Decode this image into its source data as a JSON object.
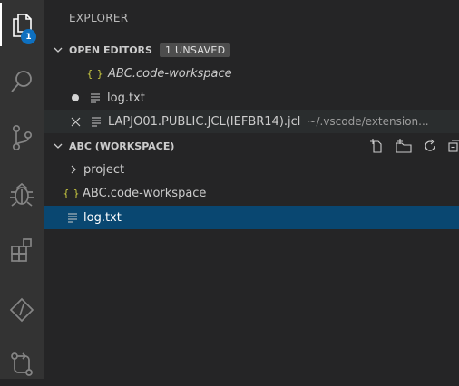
{
  "activity_bar": {
    "explorer_badge": "1",
    "items": [
      "explorer-icon",
      "search-icon",
      "source-control-icon",
      "debug-icon",
      "extensions-icon",
      "zowe-icon",
      "pull-request-icon"
    ]
  },
  "sidebar": {
    "title": "EXPLORER",
    "open_editors": {
      "label": "OPEN EDITORS",
      "badge": "1 UNSAVED",
      "items": [
        {
          "name": "ABC.code-workspace",
          "icon": "json-braces-icon",
          "italic": true
        },
        {
          "name": "log.txt",
          "icon": "text-file-icon",
          "modified": true
        },
        {
          "name": "LAPJO01.PUBLIC.JCL(IEFBR14).jcl",
          "icon": "text-file-icon",
          "description": "~/.vscode/extension..."
        }
      ]
    },
    "workspace": {
      "label": "ABC (WORKSPACE)",
      "actions": [
        "new-file-icon",
        "new-folder-icon",
        "refresh-icon",
        "collapse-all-icon"
      ],
      "items": [
        {
          "name": "project",
          "type": "folder"
        },
        {
          "name": "ABC.code-workspace",
          "type": "file"
        },
        {
          "name": "log.txt",
          "type": "file",
          "selected": true
        }
      ]
    }
  },
  "colors": {
    "activity_bar_bg": "#333333",
    "sidebar_bg": "#252526",
    "selection_bg": "#094771",
    "badge_bg": "#0e70c0",
    "json_icon": "#cbcb41"
  }
}
